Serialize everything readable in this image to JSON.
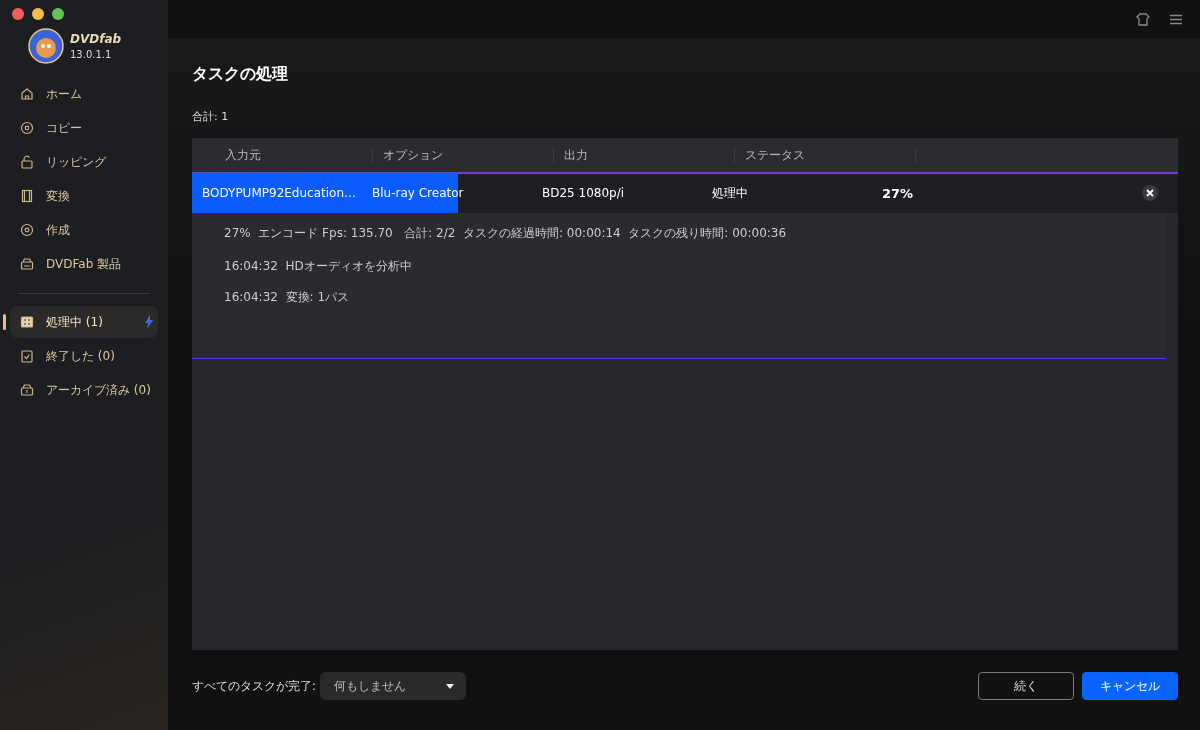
{
  "app": {
    "name": "DVDfab",
    "version": "13.0.1.1"
  },
  "nav": [
    {
      "label": "ホーム",
      "selected": false
    },
    {
      "label": "コピー",
      "selected": false
    },
    {
      "label": "リッピング",
      "selected": false
    },
    {
      "label": "変換",
      "selected": false
    },
    {
      "label": "作成",
      "selected": false
    },
    {
      "label": "DVDFab 製品",
      "selected": false
    }
  ],
  "task_nav": [
    {
      "label": "処理中 (1)",
      "selected": true
    },
    {
      "label": "終了した (0)",
      "selected": false
    },
    {
      "label": "アーカイブ済み (0)",
      "selected": false
    }
  ],
  "page": {
    "title": "タスクの処理",
    "total": "合計: 1"
  },
  "table": {
    "columns": [
      "入力元",
      "オプション",
      "出力",
      "ステータス"
    ],
    "rows": [
      {
        "source": "BODYPUMP92Education…",
        "option": "Blu-ray Creator",
        "output": "BD25 1080p/i",
        "status": "処理中",
        "percent": "27%",
        "level": 0.27,
        "expanded": true,
        "details": [
          "27%  エンコード Fps: 135.70   合計: 2/2  タスクの経過時間: 00:00:14  タスクの残り時間: 00:00:36",
          "16:04:32  HDオーディオを分析中",
          "16:04:32  変換: 1パス"
        ]
      }
    ]
  },
  "footer": {
    "label": "すべてのタスクが完了:",
    "dropdown": "何もしません",
    "buttons": [
      "続く",
      "キャンセル"
    ]
  }
}
